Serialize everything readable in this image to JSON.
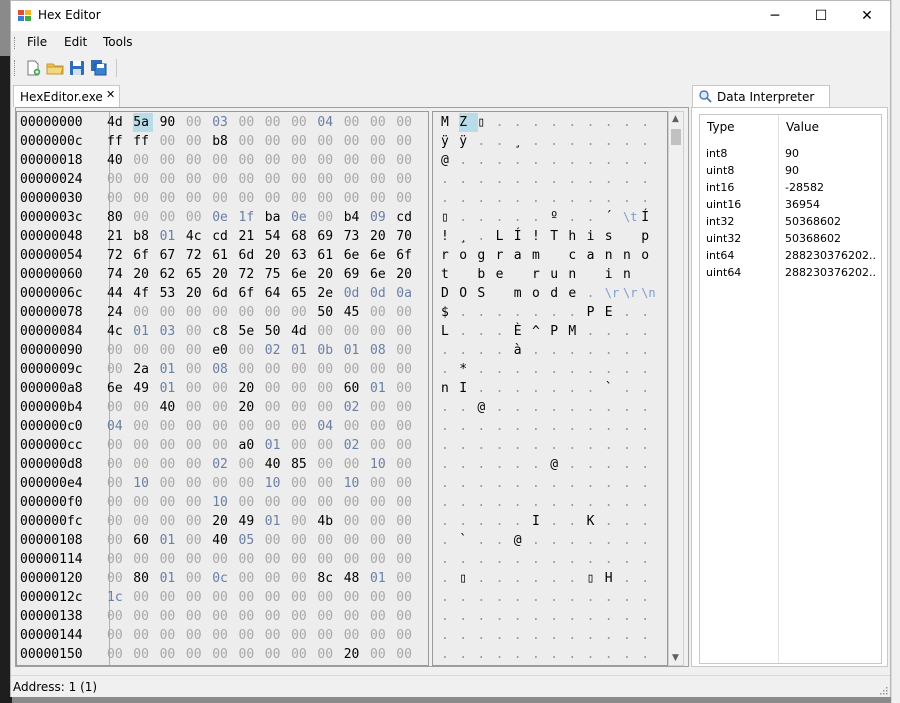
{
  "window": {
    "title": "Hex Editor",
    "controls": {
      "minimize": "─",
      "maximize": "☐",
      "close": "✕"
    }
  },
  "menu": {
    "file": "File",
    "edit": "Edit",
    "tools": "Tools"
  },
  "toolbar": {
    "buttons": [
      "new-file-icon",
      "open-folder-icon",
      "save-icon",
      "save-all-icon"
    ]
  },
  "document_tab": {
    "label": "HexEditor.exe",
    "close": "✕"
  },
  "hex_view": {
    "rows": [
      {
        "offset": "00000000",
        "bytes": [
          "4d",
          "5a",
          "90",
          "00",
          "03",
          "00",
          "00",
          "00",
          "04",
          "00",
          "00",
          "00"
        ],
        "ascii": [
          "M",
          "Z",
          "▯",
          ".",
          ".",
          ".",
          ".",
          ".",
          ".",
          ".",
          ".",
          "."
        ]
      },
      {
        "offset": "0000000c",
        "bytes": [
          "ff",
          "ff",
          "00",
          "00",
          "b8",
          "00",
          "00",
          "00",
          "00",
          "00",
          "00",
          "00"
        ],
        "ascii": [
          "ÿ",
          "ÿ",
          ".",
          ".",
          "¸",
          ".",
          ".",
          ".",
          ".",
          ".",
          ".",
          "."
        ]
      },
      {
        "offset": "00000018",
        "bytes": [
          "40",
          "00",
          "00",
          "00",
          "00",
          "00",
          "00",
          "00",
          "00",
          "00",
          "00",
          "00"
        ],
        "ascii": [
          "@",
          ".",
          ".",
          ".",
          ".",
          ".",
          ".",
          ".",
          ".",
          ".",
          ".",
          "."
        ]
      },
      {
        "offset": "00000024",
        "bytes": [
          "00",
          "00",
          "00",
          "00",
          "00",
          "00",
          "00",
          "00",
          "00",
          "00",
          "00",
          "00"
        ],
        "ascii": [
          ".",
          ".",
          ".",
          ".",
          ".",
          ".",
          ".",
          ".",
          ".",
          ".",
          ".",
          "."
        ]
      },
      {
        "offset": "00000030",
        "bytes": [
          "00",
          "00",
          "00",
          "00",
          "00",
          "00",
          "00",
          "00",
          "00",
          "00",
          "00",
          "00"
        ],
        "ascii": [
          ".",
          ".",
          ".",
          ".",
          ".",
          ".",
          ".",
          ".",
          ".",
          ".",
          ".",
          "."
        ]
      },
      {
        "offset": "0000003c",
        "bytes": [
          "80",
          "00",
          "00",
          "00",
          "0e",
          "1f",
          "ba",
          "0e",
          "00",
          "b4",
          "09",
          "cd"
        ],
        "ascii": [
          "▯",
          ".",
          ".",
          ".",
          ".",
          ".",
          "º",
          ".",
          ".",
          "´",
          "\\t",
          "Í"
        ]
      },
      {
        "offset": "00000048",
        "bytes": [
          "21",
          "b8",
          "01",
          "4c",
          "cd",
          "21",
          "54",
          "68",
          "69",
          "73",
          "20",
          "70"
        ],
        "ascii": [
          "!",
          "¸",
          ".",
          "L",
          "Í",
          "!",
          "T",
          "h",
          "i",
          "s",
          " ",
          "p"
        ]
      },
      {
        "offset": "00000054",
        "bytes": [
          "72",
          "6f",
          "67",
          "72",
          "61",
          "6d",
          "20",
          "63",
          "61",
          "6e",
          "6e",
          "6f"
        ],
        "ascii": [
          "r",
          "o",
          "g",
          "r",
          "a",
          "m",
          " ",
          "c",
          "a",
          "n",
          "n",
          "o"
        ]
      },
      {
        "offset": "00000060",
        "bytes": [
          "74",
          "20",
          "62",
          "65",
          "20",
          "72",
          "75",
          "6e",
          "20",
          "69",
          "6e",
          "20"
        ],
        "ascii": [
          "t",
          " ",
          "b",
          "e",
          " ",
          "r",
          "u",
          "n",
          " ",
          "i",
          "n",
          " "
        ]
      },
      {
        "offset": "0000006c",
        "bytes": [
          "44",
          "4f",
          "53",
          "20",
          "6d",
          "6f",
          "64",
          "65",
          "2e",
          "0d",
          "0d",
          "0a"
        ],
        "ascii": [
          "D",
          "O",
          "S",
          " ",
          "m",
          "o",
          "d",
          "e",
          ".",
          "\\r",
          "\\r",
          "\\n"
        ]
      },
      {
        "offset": "00000078",
        "bytes": [
          "24",
          "00",
          "00",
          "00",
          "00",
          "00",
          "00",
          "00",
          "50",
          "45",
          "00",
          "00"
        ],
        "ascii": [
          "$",
          ".",
          ".",
          ".",
          ".",
          ".",
          ".",
          ".",
          "P",
          "E",
          ".",
          "."
        ]
      },
      {
        "offset": "00000084",
        "bytes": [
          "4c",
          "01",
          "03",
          "00",
          "c8",
          "5e",
          "50",
          "4d",
          "00",
          "00",
          "00",
          "00"
        ],
        "ascii": [
          "L",
          ".",
          ".",
          ".",
          "È",
          "^",
          "P",
          "M",
          ".",
          ".",
          ".",
          "."
        ]
      },
      {
        "offset": "00000090",
        "bytes": [
          "00",
          "00",
          "00",
          "00",
          "e0",
          "00",
          "02",
          "01",
          "0b",
          "01",
          "08",
          "00"
        ],
        "ascii": [
          ".",
          ".",
          ".",
          ".",
          "à",
          ".",
          ".",
          ".",
          ".",
          ".",
          ".",
          "."
        ]
      },
      {
        "offset": "0000009c",
        "bytes": [
          "00",
          "2a",
          "01",
          "00",
          "08",
          "00",
          "00",
          "00",
          "00",
          "00",
          "00",
          "00"
        ],
        "ascii": [
          ".",
          "*",
          ".",
          ".",
          ".",
          ".",
          ".",
          ".",
          ".",
          ".",
          ".",
          "."
        ]
      },
      {
        "offset": "000000a8",
        "bytes": [
          "6e",
          "49",
          "01",
          "00",
          "00",
          "20",
          "00",
          "00",
          "00",
          "60",
          "01",
          "00"
        ],
        "ascii": [
          "n",
          "I",
          ".",
          ".",
          ".",
          ".",
          ".",
          ".",
          ".",
          "`",
          ".",
          "."
        ]
      },
      {
        "offset": "000000b4",
        "bytes": [
          "00",
          "00",
          "40",
          "00",
          "00",
          "20",
          "00",
          "00",
          "00",
          "02",
          "00",
          "00"
        ],
        "ascii": [
          ".",
          ".",
          "@",
          ".",
          ".",
          ".",
          ".",
          ".",
          ".",
          ".",
          ".",
          "."
        ]
      },
      {
        "offset": "000000c0",
        "bytes": [
          "04",
          "00",
          "00",
          "00",
          "00",
          "00",
          "00",
          "00",
          "04",
          "00",
          "00",
          "00"
        ],
        "ascii": [
          ".",
          ".",
          ".",
          ".",
          ".",
          ".",
          ".",
          ".",
          ".",
          ".",
          ".",
          "."
        ]
      },
      {
        "offset": "000000cc",
        "bytes": [
          "00",
          "00",
          "00",
          "00",
          "00",
          "a0",
          "01",
          "00",
          "00",
          "02",
          "00",
          "00"
        ],
        "ascii": [
          ".",
          ".",
          ".",
          ".",
          ".",
          ".",
          ".",
          ".",
          ".",
          ".",
          ".",
          "."
        ]
      },
      {
        "offset": "000000d8",
        "bytes": [
          "00",
          "00",
          "00",
          "00",
          "02",
          "00",
          "40",
          "85",
          "00",
          "00",
          "10",
          "00"
        ],
        "ascii": [
          ".",
          ".",
          ".",
          ".",
          ".",
          ".",
          "@",
          ".",
          ".",
          ".",
          ".",
          "."
        ]
      },
      {
        "offset": "000000e4",
        "bytes": [
          "00",
          "10",
          "00",
          "00",
          "00",
          "00",
          "10",
          "00",
          "00",
          "10",
          "00",
          "00"
        ],
        "ascii": [
          ".",
          ".",
          ".",
          ".",
          ".",
          ".",
          ".",
          ".",
          ".",
          ".",
          ".",
          "."
        ]
      },
      {
        "offset": "000000f0",
        "bytes": [
          "00",
          "00",
          "00",
          "00",
          "10",
          "00",
          "00",
          "00",
          "00",
          "00",
          "00",
          "00"
        ],
        "ascii": [
          ".",
          ".",
          ".",
          ".",
          ".",
          ".",
          ".",
          ".",
          ".",
          ".",
          ".",
          "."
        ]
      },
      {
        "offset": "000000fc",
        "bytes": [
          "00",
          "00",
          "00",
          "00",
          "20",
          "49",
          "01",
          "00",
          "4b",
          "00",
          "00",
          "00"
        ],
        "ascii": [
          ".",
          ".",
          ".",
          ".",
          ".",
          "I",
          ".",
          ".",
          "K",
          ".",
          ".",
          "."
        ]
      },
      {
        "offset": "00000108",
        "bytes": [
          "00",
          "60",
          "01",
          "00",
          "40",
          "05",
          "00",
          "00",
          "00",
          "00",
          "00",
          "00"
        ],
        "ascii": [
          ".",
          "`",
          ".",
          ".",
          "@",
          ".",
          ".",
          ".",
          ".",
          ".",
          ".",
          "."
        ]
      },
      {
        "offset": "00000114",
        "bytes": [
          "00",
          "00",
          "00",
          "00",
          "00",
          "00",
          "00",
          "00",
          "00",
          "00",
          "00",
          "00"
        ],
        "ascii": [
          ".",
          ".",
          ".",
          ".",
          ".",
          ".",
          ".",
          ".",
          ".",
          ".",
          ".",
          "."
        ]
      },
      {
        "offset": "00000120",
        "bytes": [
          "00",
          "80",
          "01",
          "00",
          "0c",
          "00",
          "00",
          "00",
          "8c",
          "48",
          "01",
          "00"
        ],
        "ascii": [
          ".",
          "▯",
          ".",
          ".",
          ".",
          ".",
          ".",
          ".",
          "▯",
          "H",
          ".",
          "."
        ]
      },
      {
        "offset": "0000012c",
        "bytes": [
          "1c",
          "00",
          "00",
          "00",
          "00",
          "00",
          "00",
          "00",
          "00",
          "00",
          "00",
          "00"
        ],
        "ascii": [
          ".",
          ".",
          ".",
          ".",
          ".",
          ".",
          ".",
          ".",
          ".",
          ".",
          ".",
          "."
        ]
      },
      {
        "offset": "00000138",
        "bytes": [
          "00",
          "00",
          "00",
          "00",
          "00",
          "00",
          "00",
          "00",
          "00",
          "00",
          "00",
          "00"
        ],
        "ascii": [
          ".",
          ".",
          ".",
          ".",
          ".",
          ".",
          ".",
          ".",
          ".",
          ".",
          ".",
          "."
        ]
      },
      {
        "offset": "00000144",
        "bytes": [
          "00",
          "00",
          "00",
          "00",
          "00",
          "00",
          "00",
          "00",
          "00",
          "00",
          "00",
          "00"
        ],
        "ascii": [
          ".",
          ".",
          ".",
          ".",
          ".",
          ".",
          ".",
          ".",
          ".",
          ".",
          ".",
          "."
        ]
      },
      {
        "offset": "00000150",
        "bytes": [
          "00",
          "00",
          "00",
          "00",
          "00",
          "00",
          "00",
          "00",
          "00",
          "20",
          "00",
          "00"
        ],
        "ascii": [
          ".",
          ".",
          ".",
          ".",
          ".",
          ".",
          ".",
          ".",
          ".",
          ".",
          ".",
          "."
        ]
      }
    ]
  },
  "interpreter": {
    "tab_label": "Data Interpreter",
    "headers": {
      "type": "Type",
      "value": "Value"
    },
    "rows": [
      {
        "type": "int8",
        "value": "90"
      },
      {
        "type": "uint8",
        "value": "90"
      },
      {
        "type": "int16",
        "value": "-28582"
      },
      {
        "type": "uint16",
        "value": "36954"
      },
      {
        "type": "int32",
        "value": "50368602"
      },
      {
        "type": "uint32",
        "value": "50368602"
      },
      {
        "type": "int64",
        "value": "288230376202..."
      },
      {
        "type": "uint64",
        "value": "288230376202..."
      }
    ]
  },
  "status": {
    "text": "Address: 1 (1)"
  }
}
